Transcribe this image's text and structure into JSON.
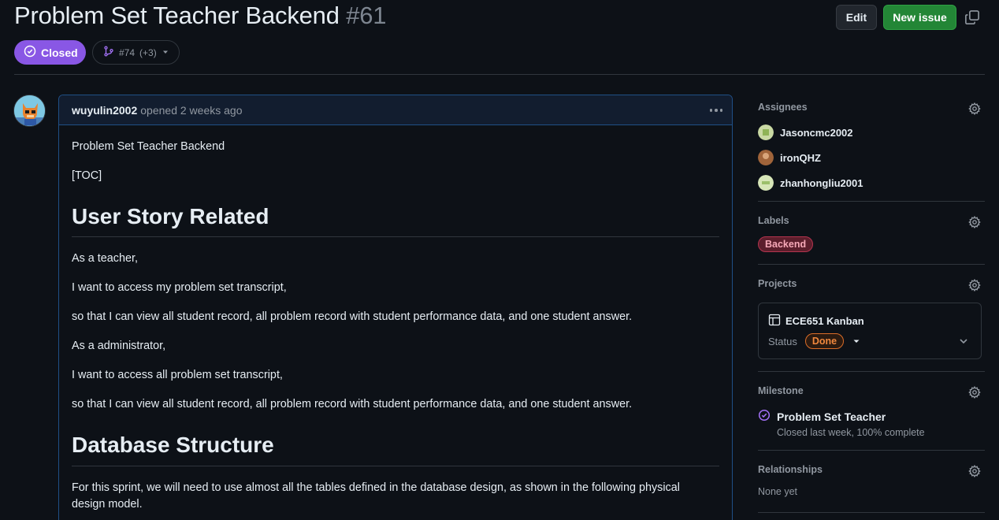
{
  "issue": {
    "title": "Problem Set Teacher Backend",
    "number": "#61",
    "state": "Closed",
    "linked_pr": "#74",
    "linked_pr_more": "(+3)"
  },
  "header_actions": {
    "edit_label": "Edit",
    "new_issue_label": "New issue"
  },
  "comment": {
    "author": "wuyulin2002",
    "opened_text": "opened 2 weeks ago",
    "body": {
      "intro": "Problem Set Teacher Backend",
      "toc": "[TOC]",
      "h1_user_story": "User Story Related",
      "p1": "As a teacher,",
      "p2": "I want to access my problem set transcript,",
      "p3": "so that I can view all student record, all problem record with student performance data, and one student answer.",
      "p4": "As a administrator,",
      "p5": "I want to access all problem set transcript,",
      "p6": "so that I can view all student record, all problem record with student performance data, and one student answer.",
      "h1_database": "Database Structure",
      "p7_line1": "For this sprint, we will need to use almost all the tables defined in the database design, as shown in the following physical",
      "p7_line2": "design model."
    }
  },
  "sidebar": {
    "assignees": {
      "heading": "Assignees",
      "people": [
        {
          "name": "Jasoncmc2002",
          "avatar_color": "#c9d9a3"
        },
        {
          "name": "ironQHZ",
          "avatar_color": "#a0643a"
        },
        {
          "name": "zhanhongliu2001",
          "avatar_color": "#d7e6b8"
        }
      ]
    },
    "labels": {
      "heading": "Labels",
      "items": [
        "Backend"
      ]
    },
    "projects": {
      "heading": "Projects",
      "project_name": "ECE651 Kanban",
      "status_label": "Status",
      "status_value": "Done"
    },
    "milestone": {
      "heading": "Milestone",
      "title": "Problem Set Teacher",
      "subtitle": "Closed last week, 100% complete"
    },
    "relationships": {
      "heading": "Relationships",
      "value": "None yet"
    }
  },
  "colors": {
    "background": "#0d1117",
    "closed_purple": "#8957e5",
    "new_issue_green": "#238636",
    "comment_border": "#1f4f86",
    "label_backend": "#b3344e",
    "status_done": "#db6d28"
  }
}
